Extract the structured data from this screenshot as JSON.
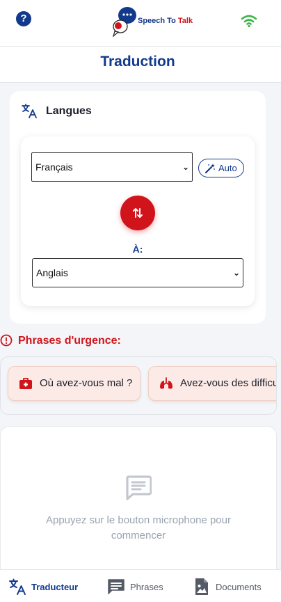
{
  "header": {
    "help_icon": "question-circle-icon",
    "help_symbol": "?",
    "logo": {
      "name_part1": "Speech To ",
      "name_part2": "Talk"
    },
    "status_icon": "wifi-icon",
    "status_color": "#3db64a"
  },
  "page": {
    "title": "Traduction"
  },
  "languages": {
    "heading": "Langues",
    "heading_icon": "translate-icon",
    "source_selected": "Français",
    "auto_label": "Auto",
    "auto_icon": "magic-wand-icon",
    "swap_icon": "swap-vertical-icon",
    "to_label": "À:",
    "target_selected": "Anglais"
  },
  "emergency": {
    "title": "Phrases d'urgence:",
    "title_icon": "alert-circle-icon",
    "chips": [
      {
        "label": "Où avez-vous mal ?",
        "icon": "medical-bag-icon"
      },
      {
        "label": "Avez-vous des difficu",
        "icon": "lungs-icon"
      }
    ]
  },
  "transcript": {
    "empty_icon": "chat-message-icon",
    "empty_text": "Appuyez sur le bouton microphone pour commencer"
  },
  "nav": {
    "items": [
      {
        "label": "Traducteur",
        "icon": "translate-icon",
        "active": true
      },
      {
        "label": "Phrases",
        "icon": "message-icon",
        "active": false
      },
      {
        "label": "Documents",
        "icon": "document-image-icon",
        "active": false
      }
    ]
  },
  "colors": {
    "primary": "#123a8c",
    "accent_red": "#d1141b",
    "background": "#f4f5f8",
    "chip_bg": "#fbeae6",
    "muted_text": "#9aa3b0"
  }
}
